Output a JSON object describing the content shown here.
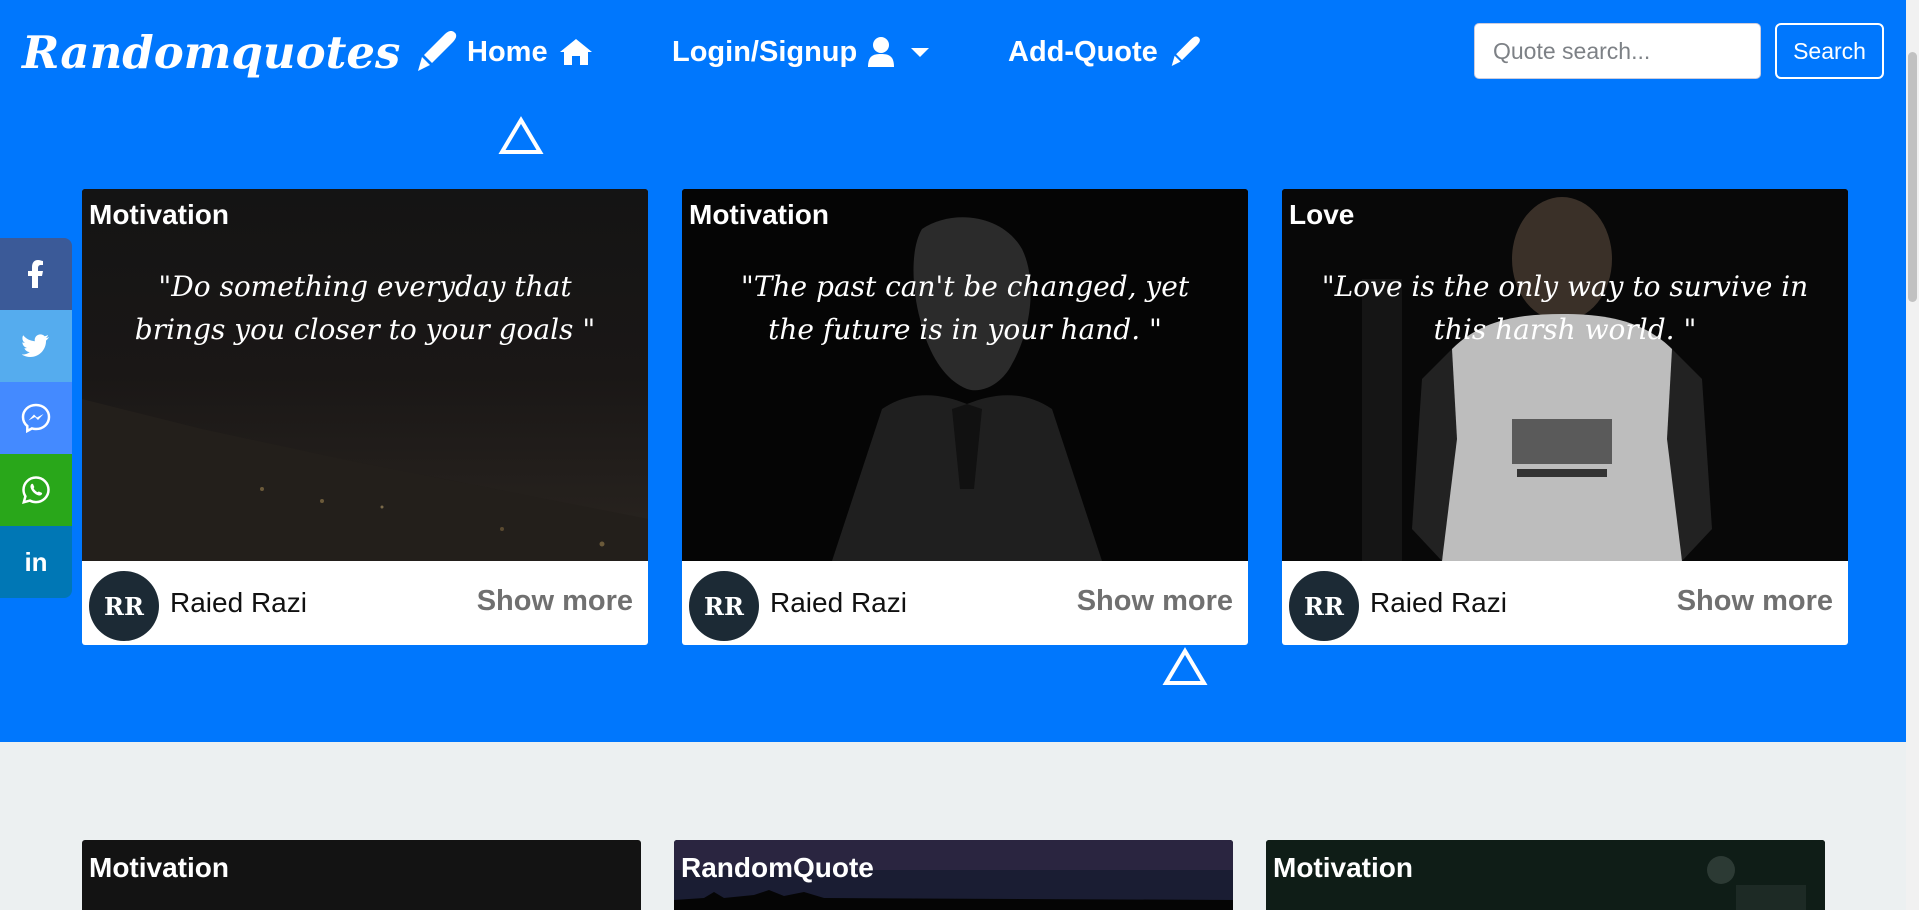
{
  "nav": {
    "brand": "Randomquotes",
    "home_label": "Home",
    "login_label": "Login/Signup",
    "add_label": "Add-Quote"
  },
  "search": {
    "placeholder": "Quote search...",
    "button_label": "Search"
  },
  "social": {
    "facebook": "f",
    "linkedin": "in"
  },
  "cards": [
    {
      "category": "Motivation",
      "quote": "\"Do something everyday that brings you closer to your goals \"",
      "initials": "RR",
      "author": "Raied Razi",
      "more": "Show more"
    },
    {
      "category": "Motivation",
      "quote": "\"The past can't be changed, yet the future is in your hand. \"",
      "initials": "RR",
      "author": "Raied Razi",
      "more": "Show more"
    },
    {
      "category": "Love",
      "quote": "\"Love is the only way to survive in this harsh world. \"",
      "initials": "RR",
      "author": "Raied Razi",
      "more": "Show more"
    }
  ],
  "cards_row2": [
    {
      "category": "Motivation"
    },
    {
      "category": "RandomQuote"
    },
    {
      "category": "Motivation"
    }
  ],
  "colors": {
    "hero": "#0077fd",
    "page_bg": "#ecf0f1",
    "facebook": "#3b5a98",
    "twitter": "#55acee",
    "messenger": "#448aff",
    "whatsapp": "#29a71a",
    "linkedin": "#0077b5"
  },
  "icons": {
    "brand": "pen-icon",
    "home": "home-icon",
    "login": "user-icon",
    "add": "pen-icon"
  }
}
